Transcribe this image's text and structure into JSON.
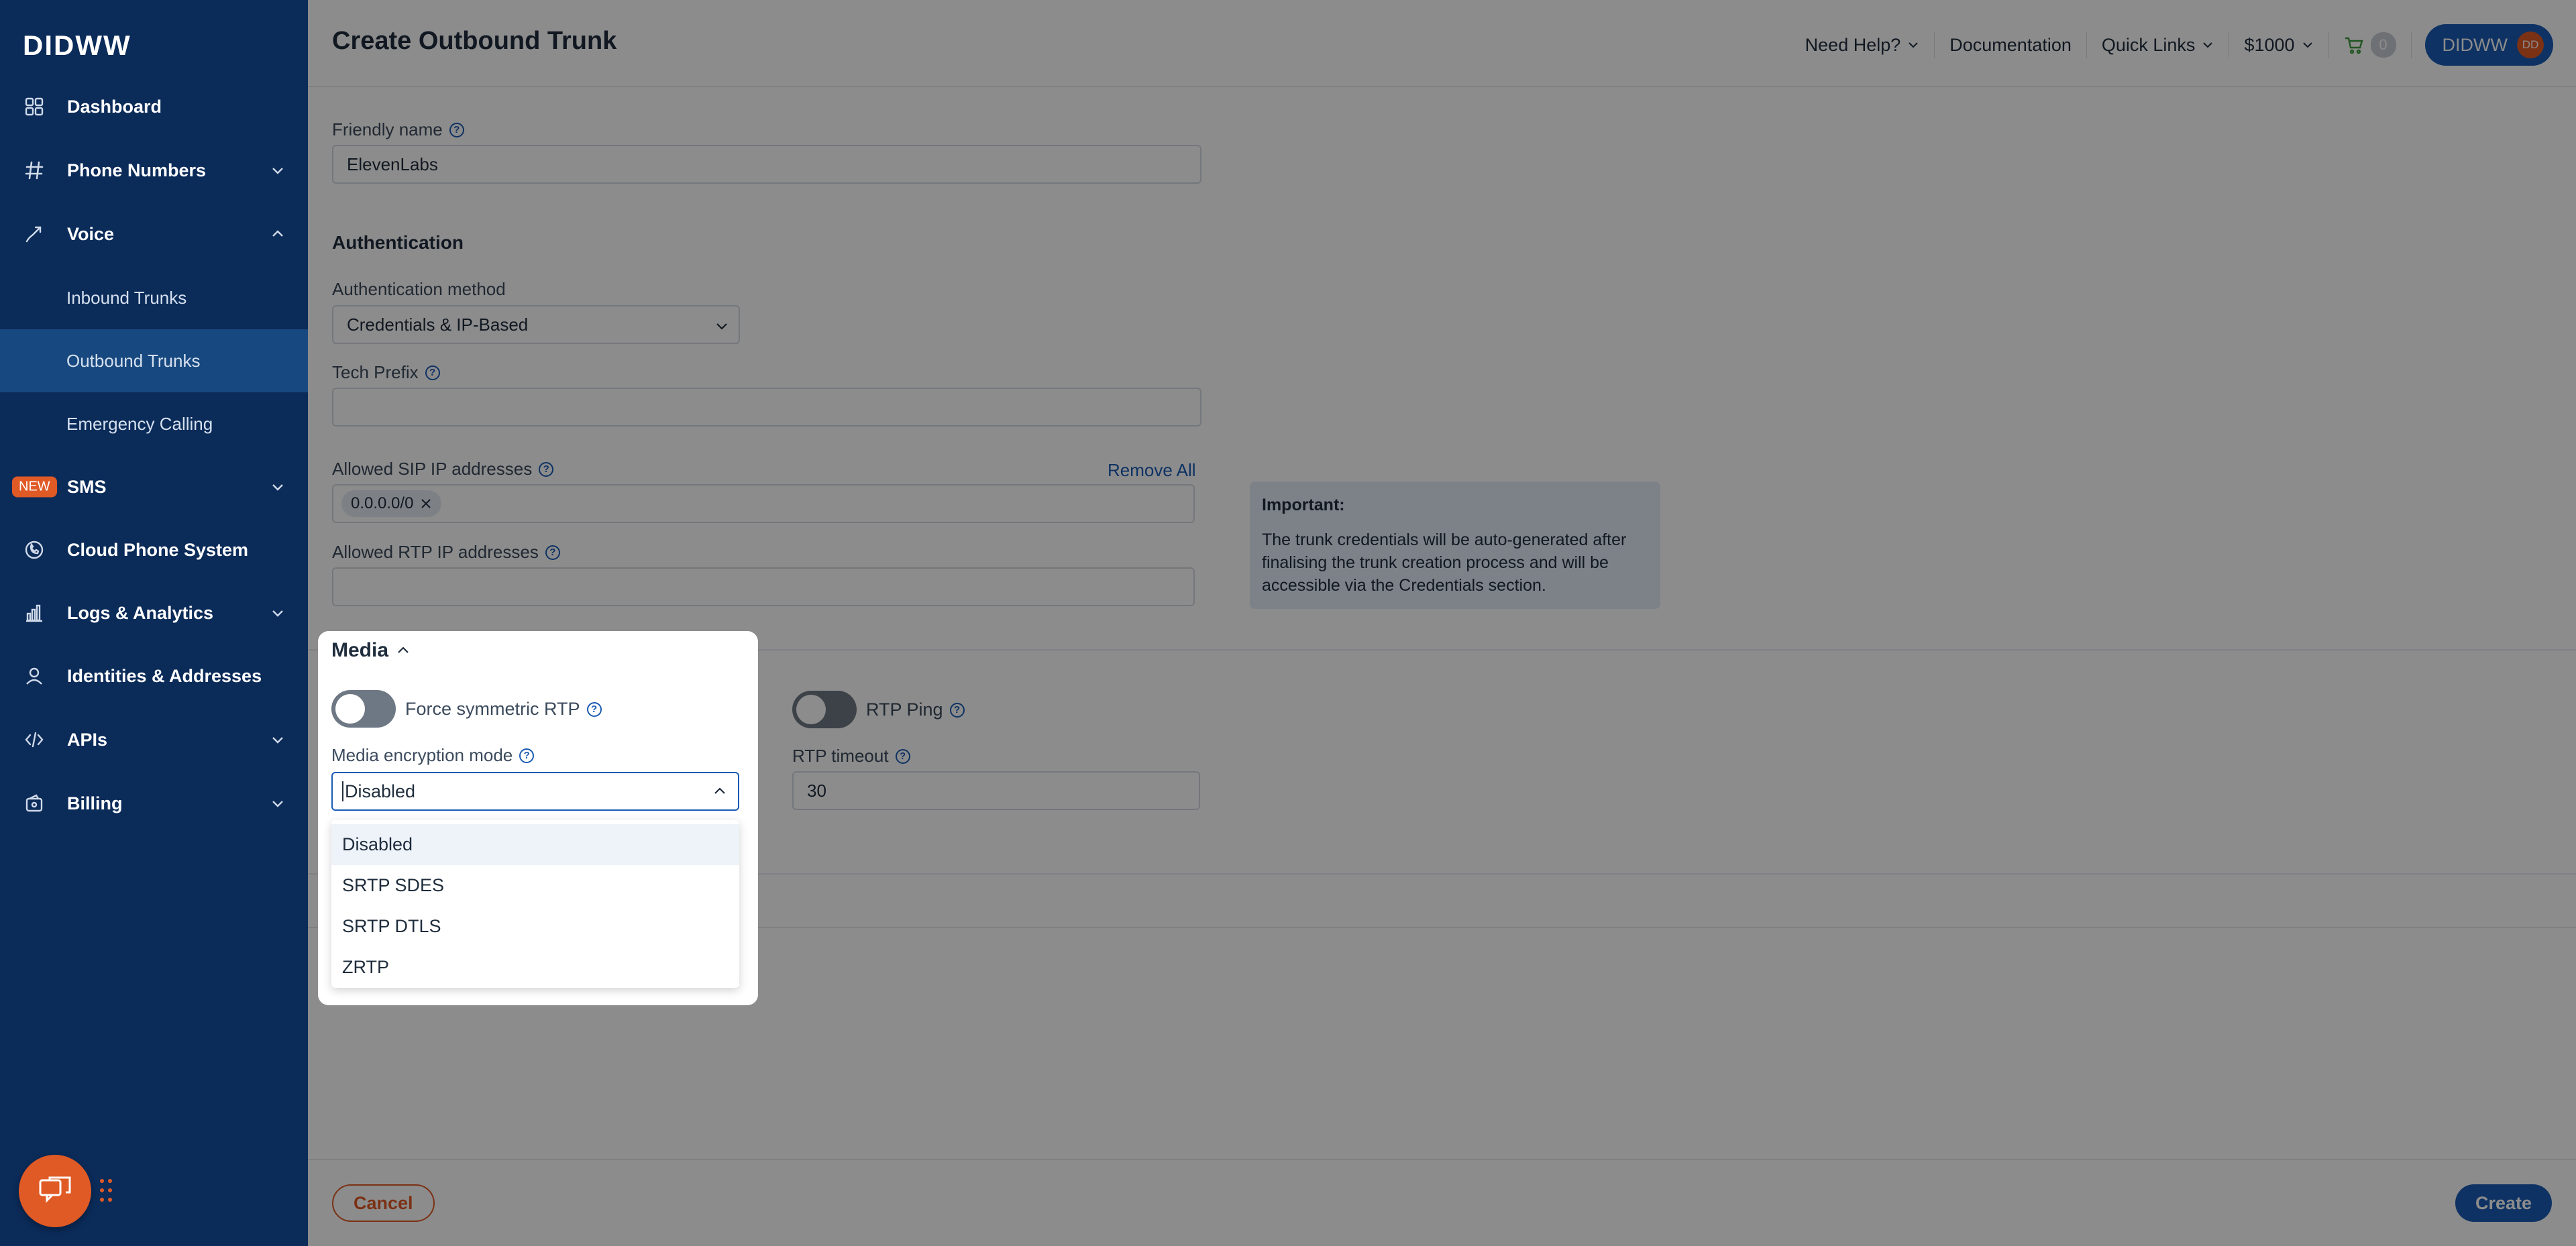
{
  "brand": "DIDWW",
  "sidebar": {
    "items": [
      {
        "label": "Dashboard"
      },
      {
        "label": "Phone Numbers"
      },
      {
        "label": "Voice"
      },
      {
        "label": "Inbound Trunks"
      },
      {
        "label": "Outbound Trunks"
      },
      {
        "label": "Emergency Calling"
      },
      {
        "label": "SMS",
        "badge": "NEW"
      },
      {
        "label": "Cloud Phone System"
      },
      {
        "label": "Logs & Analytics"
      },
      {
        "label": "Identities & Addresses"
      },
      {
        "label": "APIs"
      },
      {
        "label": "Billing"
      }
    ]
  },
  "header": {
    "title": "Create Outbound Trunk",
    "need_help": "Need Help?",
    "documentation": "Documentation",
    "quick_links": "Quick Links",
    "balance": "$1000",
    "cart_count": "0",
    "account": "DIDWW",
    "avatar_initials": "DD"
  },
  "form": {
    "friendly_name_label": "Friendly name",
    "friendly_name_value": "ElevenLabs",
    "auth_section": "Authentication",
    "auth_method_label": "Authentication method",
    "auth_method_value": "Credentials & IP-Based",
    "tech_prefix_label": "Tech Prefix",
    "tech_prefix_value": "",
    "sip_ips_label": "Allowed SIP IP addresses",
    "remove_all": "Remove All",
    "sip_ip_tag": "0.0.0.0/0",
    "rtp_ips_label": "Allowed RTP IP addresses",
    "important_title": "Important:",
    "important_text": "The trunk credentials will be auto-generated after finalising the trunk creation process and will be accessible via the Credentials section.",
    "rtp_ping_label": "RTP Ping",
    "rtp_timeout_label": "RTP timeout",
    "rtp_timeout_value": "30"
  },
  "media": {
    "title": "Media",
    "force_symmetric_label": "Force symmetric RTP",
    "encryption_label": "Media encryption mode",
    "encryption_value": "Disabled",
    "options": [
      "Disabled",
      "SRTP SDES",
      "SRTP DTLS",
      "ZRTP"
    ]
  },
  "footer": {
    "cancel": "Cancel",
    "create": "Create"
  },
  "colors": {
    "sidebar_bg": "#0b2b59",
    "sidebar_active": "#17487f",
    "primary": "#1a5bb4",
    "accent": "#e05a26"
  }
}
